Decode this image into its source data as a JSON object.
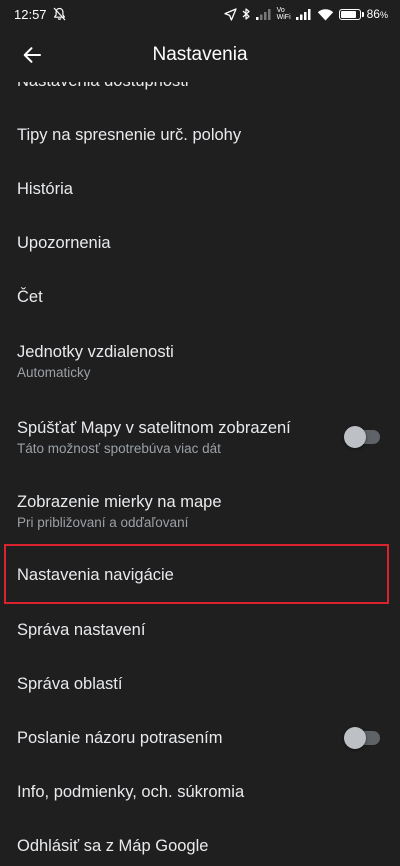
{
  "status_bar": {
    "time": "12:57",
    "vowifi_top": "Vo",
    "vowifi_bottom": "WiFi",
    "battery_percent": "86",
    "battery_suffix": "%",
    "battery_level": 0.86
  },
  "app_bar": {
    "title": "Nastavenia"
  },
  "settings": {
    "items": [
      {
        "title": "Nastavenia dostupnosti"
      },
      {
        "title": "Tipy na spresnenie urč. polohy"
      },
      {
        "title": "História"
      },
      {
        "title": "Upozornenia"
      },
      {
        "title": "Čet"
      },
      {
        "title": "Jednotky vzdialenosti",
        "subtitle": "Automaticky"
      },
      {
        "title": "Spúšťať Mapy v satelitnom zobrazení",
        "subtitle": "Táto možnosť spotrebúva viac dát",
        "toggle": false
      },
      {
        "title": "Zobrazenie mierky na mape",
        "subtitle": "Pri približovaní a odďaľovaní"
      },
      {
        "title": "Nastavenia navigácie",
        "highlighted": true
      },
      {
        "title": "Správa nastavení"
      },
      {
        "title": "Správa oblastí"
      },
      {
        "title": "Poslanie názoru potrasením",
        "toggle": false
      },
      {
        "title": "Info, podmienky, och. súkromia"
      },
      {
        "title": "Odhlásiť sa z Máp Google"
      }
    ]
  },
  "colors": {
    "background": "#1f1f1f",
    "text_primary": "#e8eaed",
    "text_secondary": "#9aa0a6",
    "highlight": "#d9232e",
    "toggle_off_track": "#5f6368",
    "toggle_off_knob": "#bdc1c6"
  }
}
